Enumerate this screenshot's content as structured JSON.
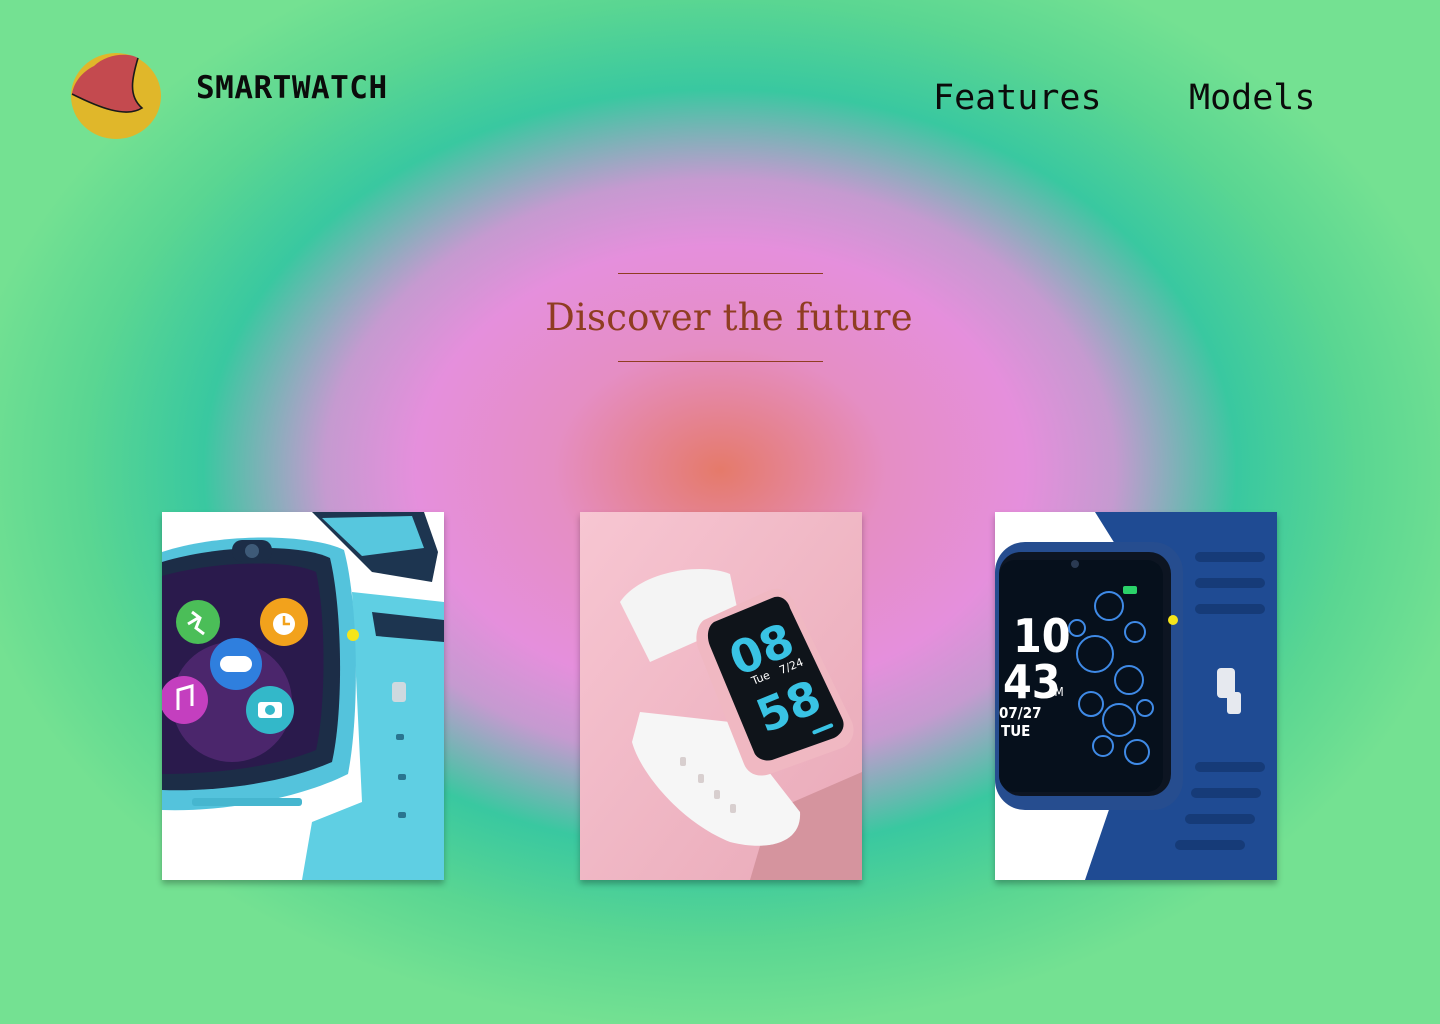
{
  "header": {
    "brand": "SMARTWATCH",
    "logo_icon": "half-moon-logo-icon",
    "nav": [
      {
        "label": "Features"
      },
      {
        "label": "Models"
      }
    ]
  },
  "hero": {
    "title": "Discover the future"
  },
  "products": [
    {
      "image": "blue-kids-smartwatch-image",
      "screen_icons": [
        "running-app-icon",
        "alarm-app-icon",
        "game-app-icon",
        "music-app-icon",
        "camera-app-icon"
      ]
    },
    {
      "image": "white-pink-smartwatch-image",
      "screen": {
        "hour": "08",
        "minute": "58",
        "day": "Tue",
        "date": "7/24"
      }
    },
    {
      "image": "navy-square-smartwatch-image",
      "screen": {
        "hour": "10",
        "minute": "43",
        "ampm": "AM",
        "date": "07/27",
        "day": "TUE"
      }
    }
  ],
  "colors": {
    "background_outer": "#74e192",
    "background_mid": "#39c8a0",
    "background_inner": "#e58fdc",
    "background_center": "#e57a6a",
    "hero_text": "#8f3d22",
    "logo_red": "#c44a4f",
    "logo_yellow": "#e0b72a"
  }
}
